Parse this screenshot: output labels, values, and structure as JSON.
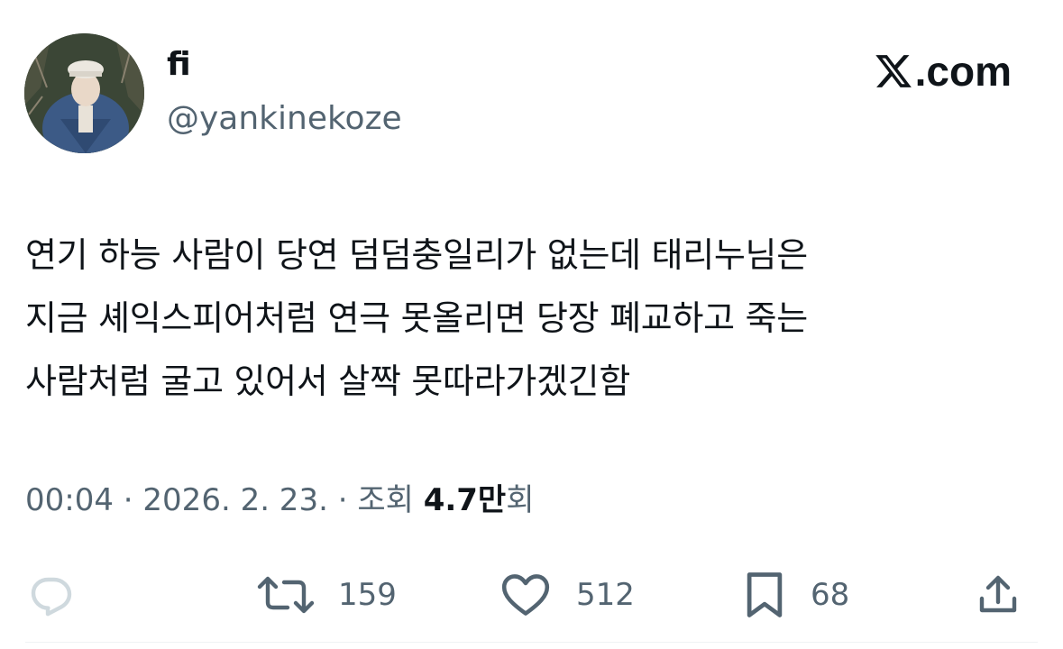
{
  "author": {
    "display_name": "fi",
    "handle": "@yankinekoze",
    "avatar_icon": "profile-photo"
  },
  "brand": {
    "label": ".com",
    "icon": "x-logo-icon"
  },
  "tweet": {
    "lines": [
      "연기 하능 사람이 당연 덤덤충일리가 없는데 태리누님은",
      "지금 셰익스피어처럼 연극 못올리면 당장 폐교하고 죽는",
      "사람처럼 굴고 있어서 살짝 못따라가겠긴함"
    ]
  },
  "meta": {
    "time": "00:04",
    "separator": "·",
    "date": "2026. 2. 23.",
    "views_label": "조회",
    "views_count": "4.7만",
    "views_suffix": "회"
  },
  "actions": {
    "reply": {
      "icon": "reply-icon",
      "count": ""
    },
    "repost": {
      "icon": "repost-icon",
      "count": "159"
    },
    "like": {
      "icon": "heart-icon",
      "count": "512"
    },
    "bookmark": {
      "icon": "bookmark-icon",
      "count": "68"
    },
    "share": {
      "icon": "share-icon"
    }
  },
  "colors": {
    "text_primary": "#0f1419",
    "text_secondary": "#536471",
    "reply_disabled": "#cfd9de",
    "background": "#ffffff"
  }
}
